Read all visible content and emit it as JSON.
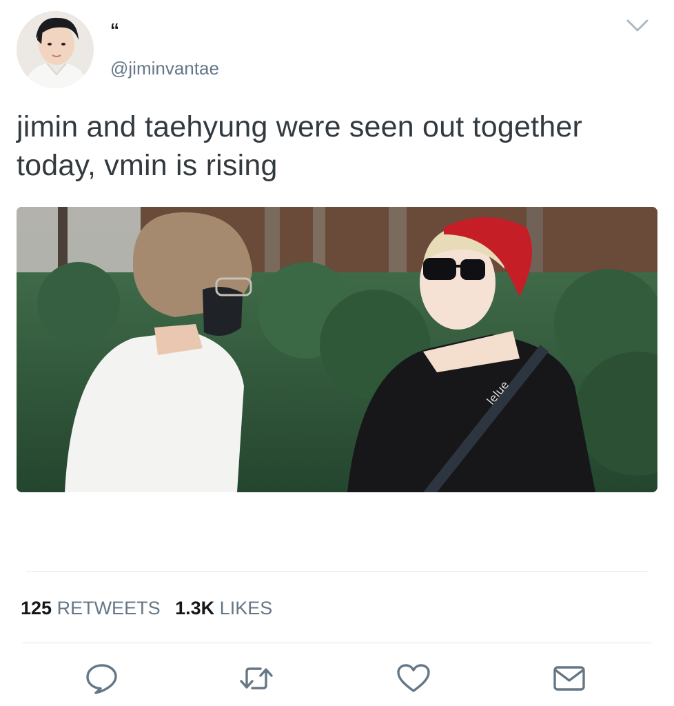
{
  "tweet": {
    "display_name": "“",
    "handle": "@jiminvantae",
    "text": "jimin and taehyung were seen out together today, vmin is rising",
    "media": {
      "description_icon": "photo"
    }
  },
  "stats": {
    "retweets_count": "125",
    "retweets_label": "RETWEETS",
    "likes_count": "1.3K",
    "likes_label": "LIKES"
  },
  "actions": {
    "reply_icon": "reply-icon",
    "retweet_icon": "retweet-icon",
    "like_icon": "heart-icon",
    "dm_icon": "envelope-icon"
  },
  "colors": {
    "text": "#14171a",
    "secondary": "#657786",
    "divider": "#e1e8ed"
  }
}
